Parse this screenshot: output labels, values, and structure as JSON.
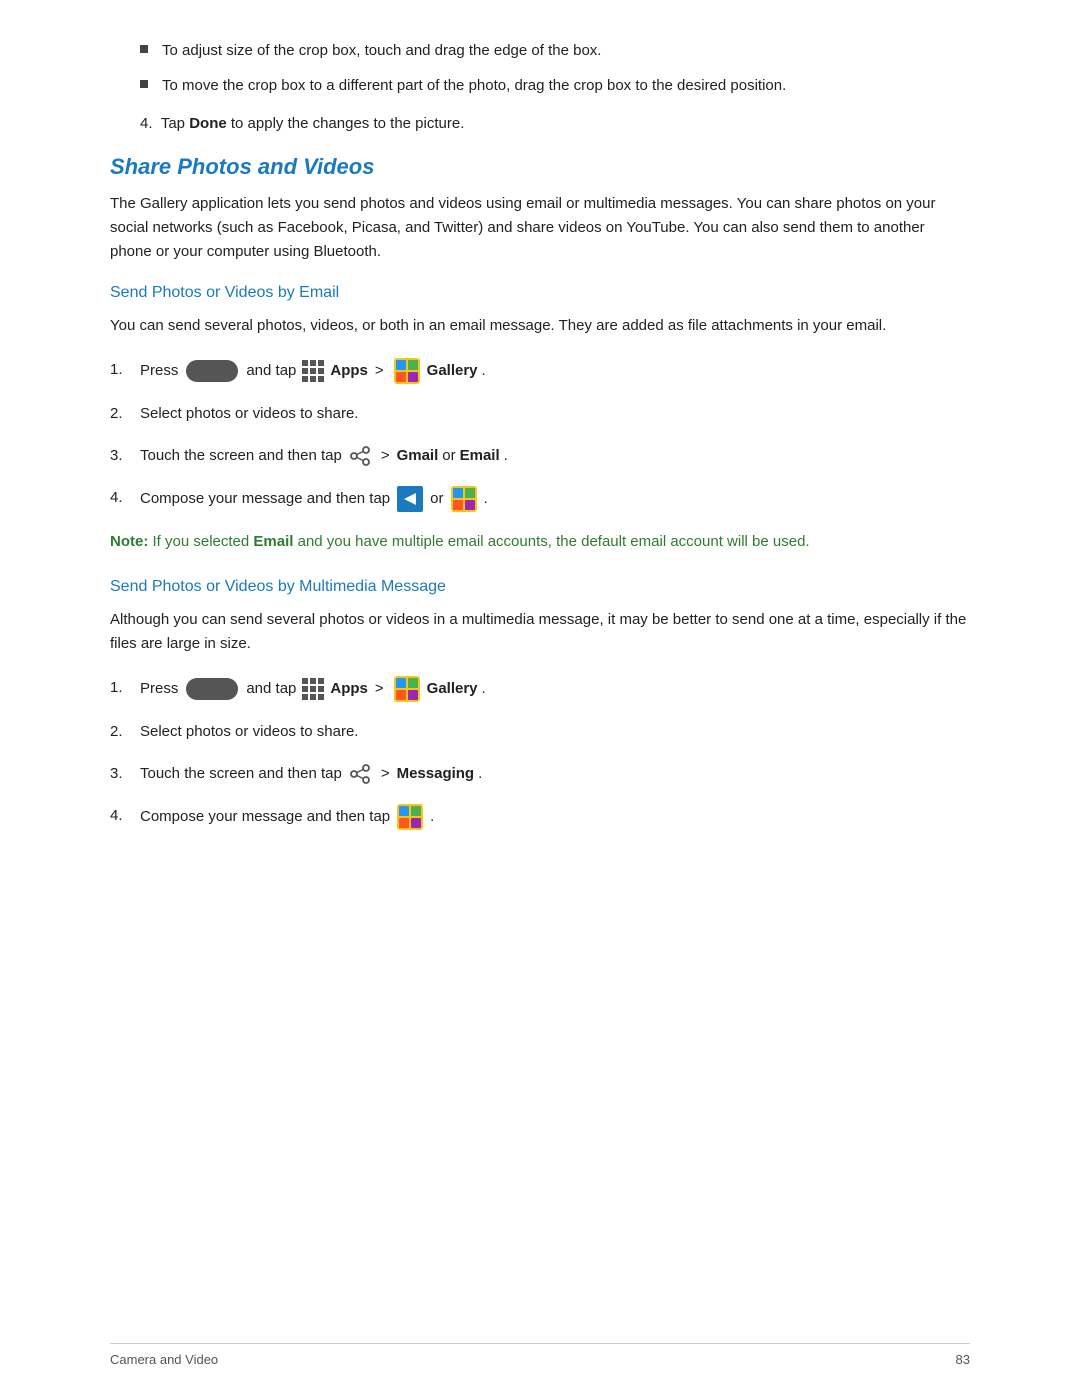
{
  "page": {
    "footer": {
      "section": "Camera and Video",
      "page_number": "83"
    }
  },
  "top_section": {
    "bullet1": "To adjust size of the crop box, touch and drag the edge of the box.",
    "bullet2": "To move the crop box to a different part of the photo, drag the crop box to the desired position.",
    "tap_done": "Tap Done to apply the changes to the picture."
  },
  "share_section": {
    "title": "Share Photos and Videos",
    "description": "The Gallery application lets you send photos and videos using email or multimedia messages. You can share photos on your social networks (such as Facebook, Picasa, and Twitter) and share videos on YouTube. You can also send them to another phone or your computer using Bluetooth.",
    "email_subsection": {
      "title": "Send Photos or Videos by Email",
      "description": "You can send several photos, videos, or both in an email message. They are added as file attachments in your email.",
      "steps": [
        {
          "number": "1.",
          "text_before": "Press",
          "and_tap": "and tap",
          "apps_label": "Apps",
          "arrow": ">",
          "gallery_label": "Gallery"
        },
        {
          "number": "2.",
          "text": "Select photos or videos to share."
        },
        {
          "number": "3.",
          "text_before": "Touch the screen and then tap",
          "arrow": ">",
          "gmail_label": "Gmail",
          "or_text": "or",
          "email_label": "Email"
        },
        {
          "number": "4.",
          "text_before": "Compose your message and then tap",
          "or_text": "or"
        }
      ],
      "note": {
        "label": "Note:",
        "text": "If you selected",
        "email_word": "Email",
        "rest": "and you have multiple email accounts, the default email account will be used."
      }
    },
    "mms_subsection": {
      "title": "Send Photos or Videos by Multimedia Message",
      "description": "Although you can send several photos or videos in a multimedia message, it may be better to send one at a time, especially if the files are large in size.",
      "steps": [
        {
          "number": "1.",
          "text_before": "Press",
          "and_tap": "and tap",
          "apps_label": "Apps",
          "arrow": ">",
          "gallery_label": "Gallery"
        },
        {
          "number": "2.",
          "text": "Select photos or videos to share."
        },
        {
          "number": "3.",
          "text_before": "Touch the screen and then tap",
          "arrow": ">",
          "messaging_label": "Messaging"
        },
        {
          "number": "4.",
          "text_before": "Compose your message and then tap"
        }
      ]
    }
  }
}
